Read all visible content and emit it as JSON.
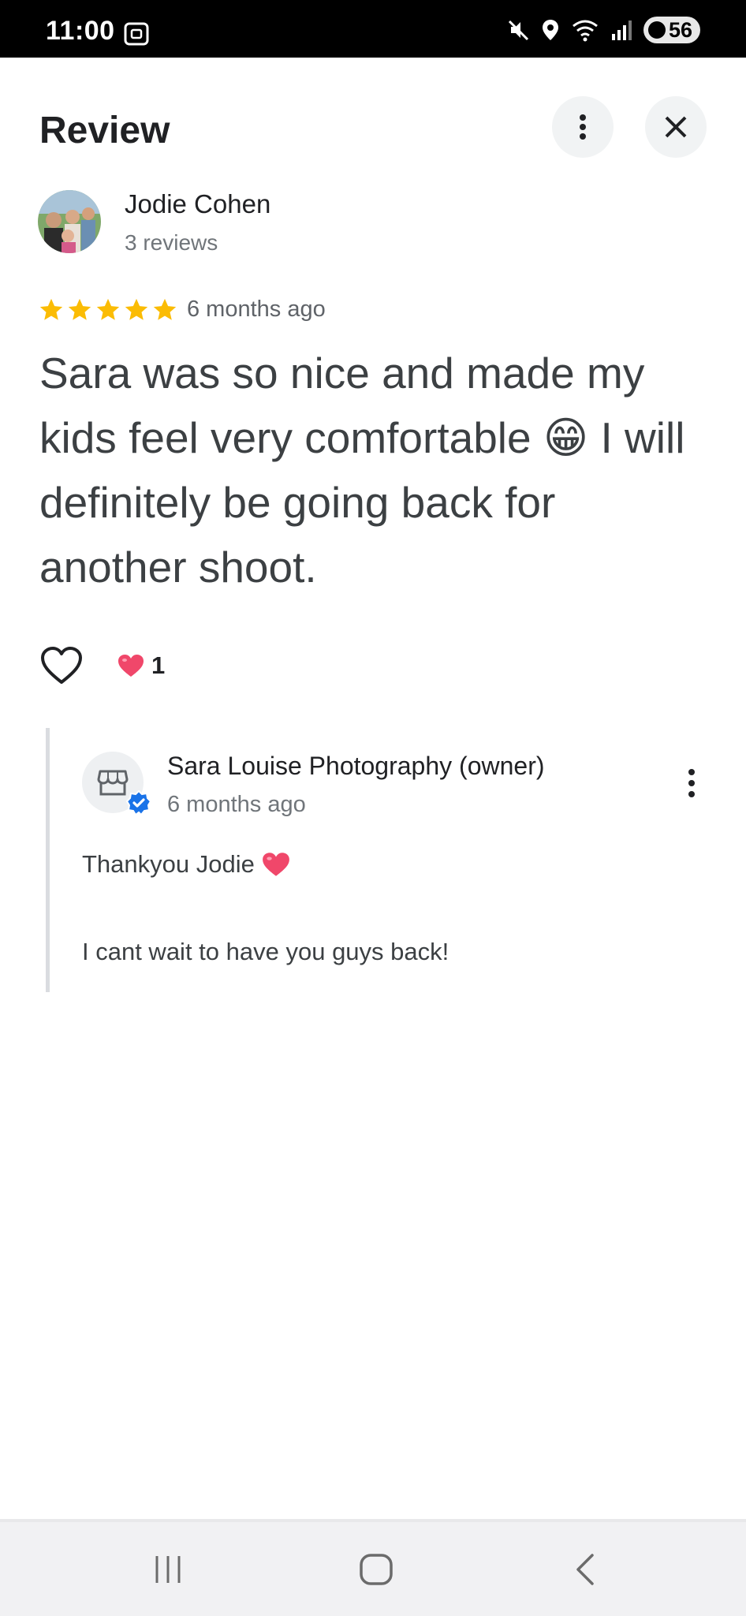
{
  "status_bar": {
    "time": "11:00",
    "battery": "56",
    "icons": [
      "screenshot-icon",
      "mute-icon",
      "location-icon",
      "wifi-icon",
      "signal-icon",
      "battery-icon"
    ]
  },
  "header": {
    "title": "Review",
    "more_icon": "more-vert-icon",
    "close_icon": "close-icon"
  },
  "review": {
    "reviewer_name": "Jodie Cohen",
    "reviewer_count": "3 reviews",
    "rating": 5,
    "rating_max": 5,
    "time": "6 months ago",
    "text": "Sara was so nice and made my kids feel very comfortable 😁 I will definitely be going back for another shoot.",
    "like_icon": "heart-outline-icon",
    "reaction_icon": "heart-icon",
    "reaction_count": "1"
  },
  "owner_reply": {
    "name": "Sara Louise Photography (owner)",
    "time": "6 months ago",
    "avatar_icon": "storefront-icon",
    "badge_icon": "verified-icon",
    "line1": "Thankyou Jodie",
    "line2": "I cant wait to have you guys back!"
  },
  "colors": {
    "star": "#fbbc04",
    "heart": "#f0476a",
    "verified": "#1a73e8"
  },
  "nav_bar": {
    "icons": [
      "recent-apps-icon",
      "home-icon",
      "back-icon"
    ]
  }
}
